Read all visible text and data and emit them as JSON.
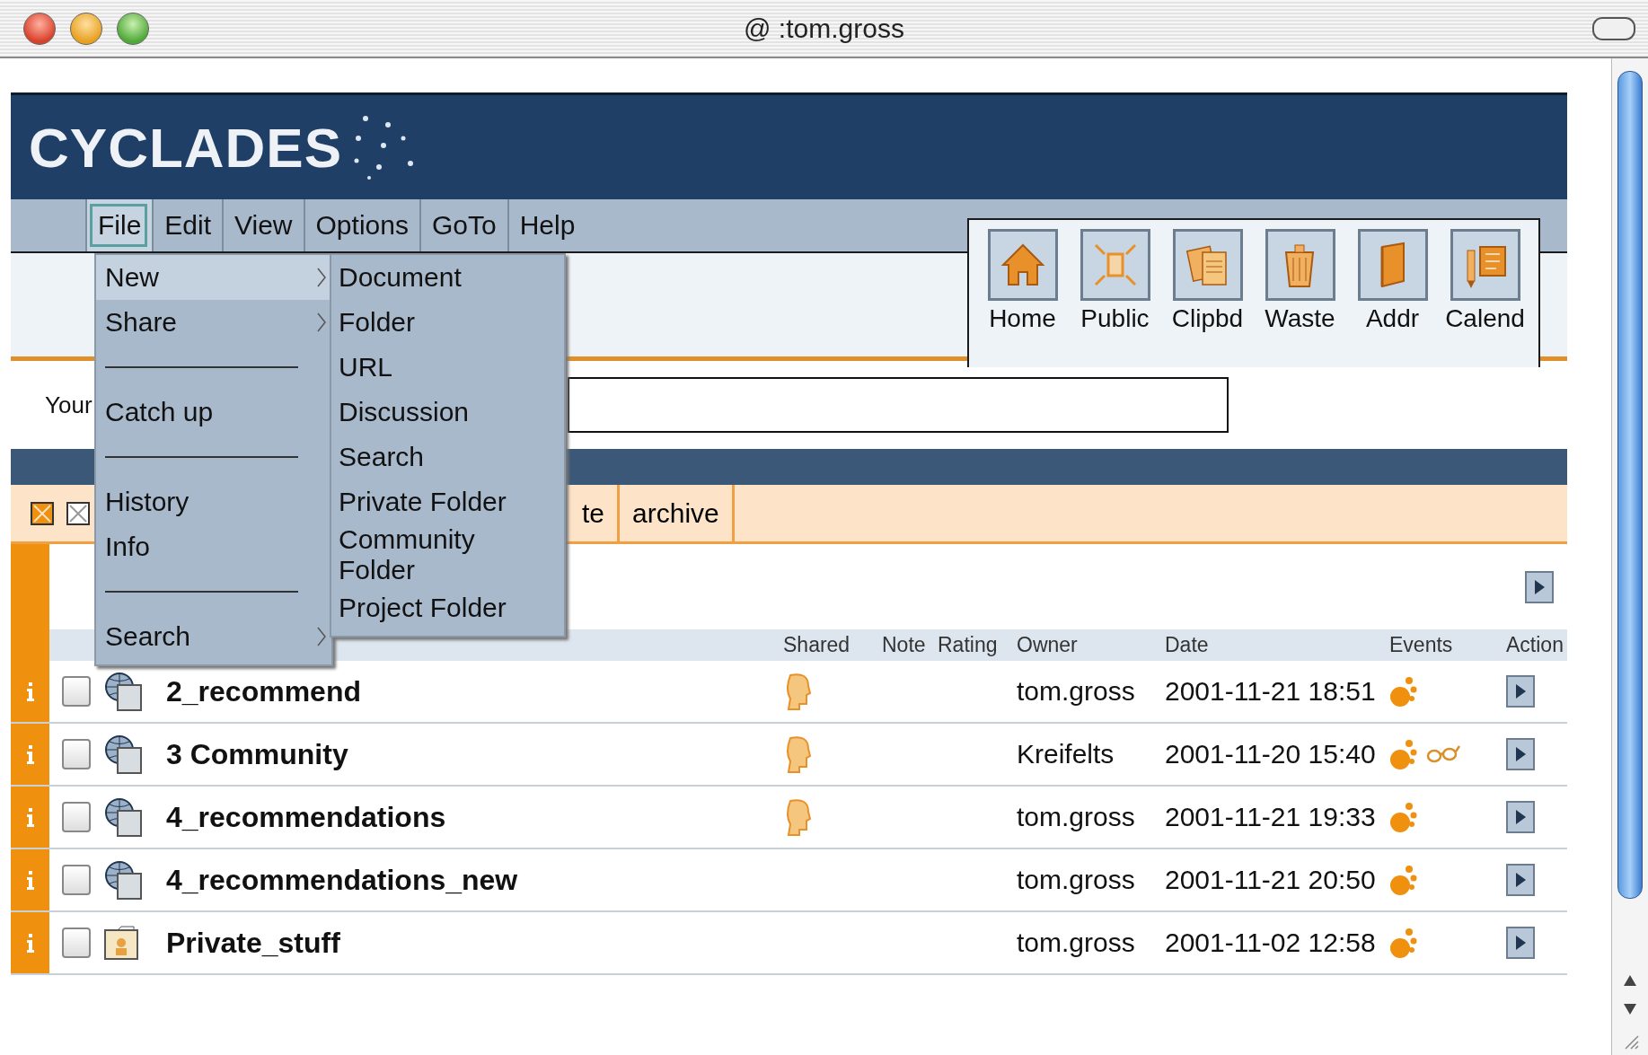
{
  "window": {
    "title": "@ :tom.gross"
  },
  "header": {
    "logo": "CYCLADES"
  },
  "menu_bar": [
    {
      "label": "File",
      "selected": true
    },
    {
      "label": "Edit",
      "selected": false
    },
    {
      "label": "View",
      "selected": false
    },
    {
      "label": "Options",
      "selected": false
    },
    {
      "label": "GoTo",
      "selected": false
    },
    {
      "label": "Help",
      "selected": false
    }
  ],
  "toolbar": [
    {
      "label": "Home"
    },
    {
      "label": "Public"
    },
    {
      "label": "Clipbd"
    },
    {
      "label": "Waste"
    },
    {
      "label": "Addr"
    },
    {
      "label": "Calend"
    }
  ],
  "prompt": {
    "label": "Your"
  },
  "tabs": [
    {
      "label": "te"
    },
    {
      "label": "archive"
    }
  ],
  "table": {
    "columns": [
      "Shared",
      "Note",
      "Rating",
      "Owner",
      "Date",
      "Events",
      "Action"
    ],
    "rows": [
      {
        "name": "2_recommend",
        "kind": "community",
        "checked": false,
        "shared": true,
        "owner": "tom.gross",
        "date": "2001-11-21 18:51",
        "glasses": false
      },
      {
        "name": "3 Community",
        "kind": "community",
        "checked": false,
        "shared": true,
        "owner": "Kreifelts",
        "date": "2001-11-20 15:40",
        "glasses": true
      },
      {
        "name": "4_recommendations",
        "kind": "community",
        "checked": false,
        "shared": true,
        "owner": "tom.gross",
        "date": "2001-11-21 19:33",
        "glasses": false
      },
      {
        "name": "4_recommendations_new",
        "kind": "community",
        "checked": false,
        "shared": false,
        "owner": "tom.gross",
        "date": "2001-11-21 20:50",
        "glasses": false
      },
      {
        "name": "Private_stuff",
        "kind": "private",
        "checked": false,
        "shared": false,
        "owner": "tom.gross",
        "date": "2001-11-02 12:58",
        "glasses": false
      }
    ]
  },
  "file_menu": [
    {
      "kind": "item",
      "label": "New",
      "submenu": true,
      "selected": true
    },
    {
      "kind": "item",
      "label": "Share",
      "submenu": true,
      "selected": false
    },
    {
      "kind": "separator"
    },
    {
      "kind": "item",
      "label": "Catch up",
      "submenu": false,
      "selected": false
    },
    {
      "kind": "separator"
    },
    {
      "kind": "item",
      "label": "History",
      "submenu": false,
      "selected": false
    },
    {
      "kind": "item",
      "label": "Info",
      "submenu": false,
      "selected": false
    },
    {
      "kind": "separator"
    },
    {
      "kind": "item",
      "label": "Search",
      "submenu": true,
      "selected": false
    }
  ],
  "new_submenu": [
    "Document",
    "Folder",
    "URL",
    "Discussion",
    "Search",
    "Private Folder",
    "Community Folder",
    "Project Folder"
  ]
}
